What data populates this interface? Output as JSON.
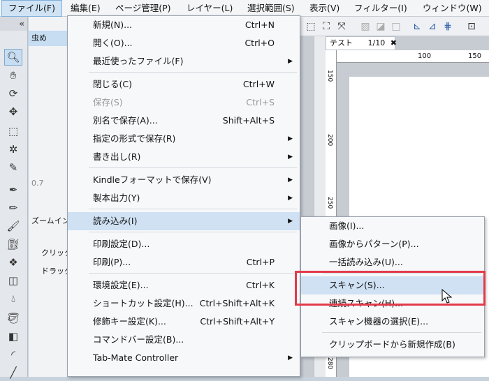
{
  "menubar": [
    {
      "label": "ファイル(F)",
      "active": true
    },
    {
      "label": "編集(E)"
    },
    {
      "label": "ページ管理(P)"
    },
    {
      "label": "レイヤー(L)"
    },
    {
      "label": "選択範囲(S)"
    },
    {
      "label": "表示(V)"
    },
    {
      "label": "フィルター(I)"
    },
    {
      "label": "ウィンドウ(W)"
    }
  ],
  "document_tab": {
    "title": "テスト",
    "page": "1/10"
  },
  "ruler": {
    "top_labels": [
      "100",
      "150"
    ],
    "left_labels": [
      "150",
      "200",
      "250",
      "280"
    ]
  },
  "left_panel": {
    "collapse_glyph": "«",
    "opacity_label": "0.7"
  },
  "sub_panel": {
    "labels": [
      "虫め",
      "ズームイン",
      "クリック",
      "ドラッグ"
    ]
  },
  "file_menu": {
    "items": [
      {
        "label": "新規(N)...",
        "shortcut": "Ctrl+N"
      },
      {
        "label": "開く(O)...",
        "shortcut": "Ctrl+O"
      },
      {
        "label": "最近使ったファイル(F)",
        "submenu": true
      },
      {
        "sep": true
      },
      {
        "label": "閉じる(C)",
        "shortcut": "Ctrl+W"
      },
      {
        "label": "保存(S)",
        "shortcut": "Ctrl+S",
        "disabled": true
      },
      {
        "label": "別名で保存(A)...",
        "shortcut": "Shift+Alt+S"
      },
      {
        "label": "指定の形式で保存(R)",
        "submenu": true
      },
      {
        "label": "書き出し(R)",
        "submenu": true
      },
      {
        "sep": true
      },
      {
        "label": "Kindleフォーマットで保存(V)",
        "submenu": true
      },
      {
        "label": "製本出力(Y)",
        "submenu": true
      },
      {
        "sep": true
      },
      {
        "label": "読み込み(I)",
        "submenu": true,
        "highlighted": true
      },
      {
        "sep": true
      },
      {
        "label": "印刷設定(D)..."
      },
      {
        "label": "印刷(P)...",
        "shortcut": "Ctrl+P"
      },
      {
        "sep": true
      },
      {
        "label": "環境設定(E)...",
        "shortcut": "Ctrl+K"
      },
      {
        "label": "ショートカット設定(H)...",
        "shortcut": "Ctrl+Shift+Alt+K"
      },
      {
        "label": "修飾キー設定(K)...",
        "shortcut": "Ctrl+Shift+Alt+Y"
      },
      {
        "label": "コマンドバー設定(B)..."
      },
      {
        "label": "Tab-Mate Controller",
        "submenu": true
      }
    ]
  },
  "import_submenu": {
    "items": [
      {
        "label": "画像(I)..."
      },
      {
        "label": "画像からパターン(P)..."
      },
      {
        "label": "一括読み込み(U)..."
      },
      {
        "sep": true
      },
      {
        "label": "スキャン(S)...",
        "highlighted": true
      },
      {
        "label": "連続スキャン(H)..."
      },
      {
        "label": "スキャン機器の選択(E)..."
      },
      {
        "sep": true
      },
      {
        "label": "クリップボードから新規作成(B)"
      }
    ]
  },
  "colors": {
    "highlight": "#cfe1f3",
    "annotation_box": "#e23a4a"
  }
}
